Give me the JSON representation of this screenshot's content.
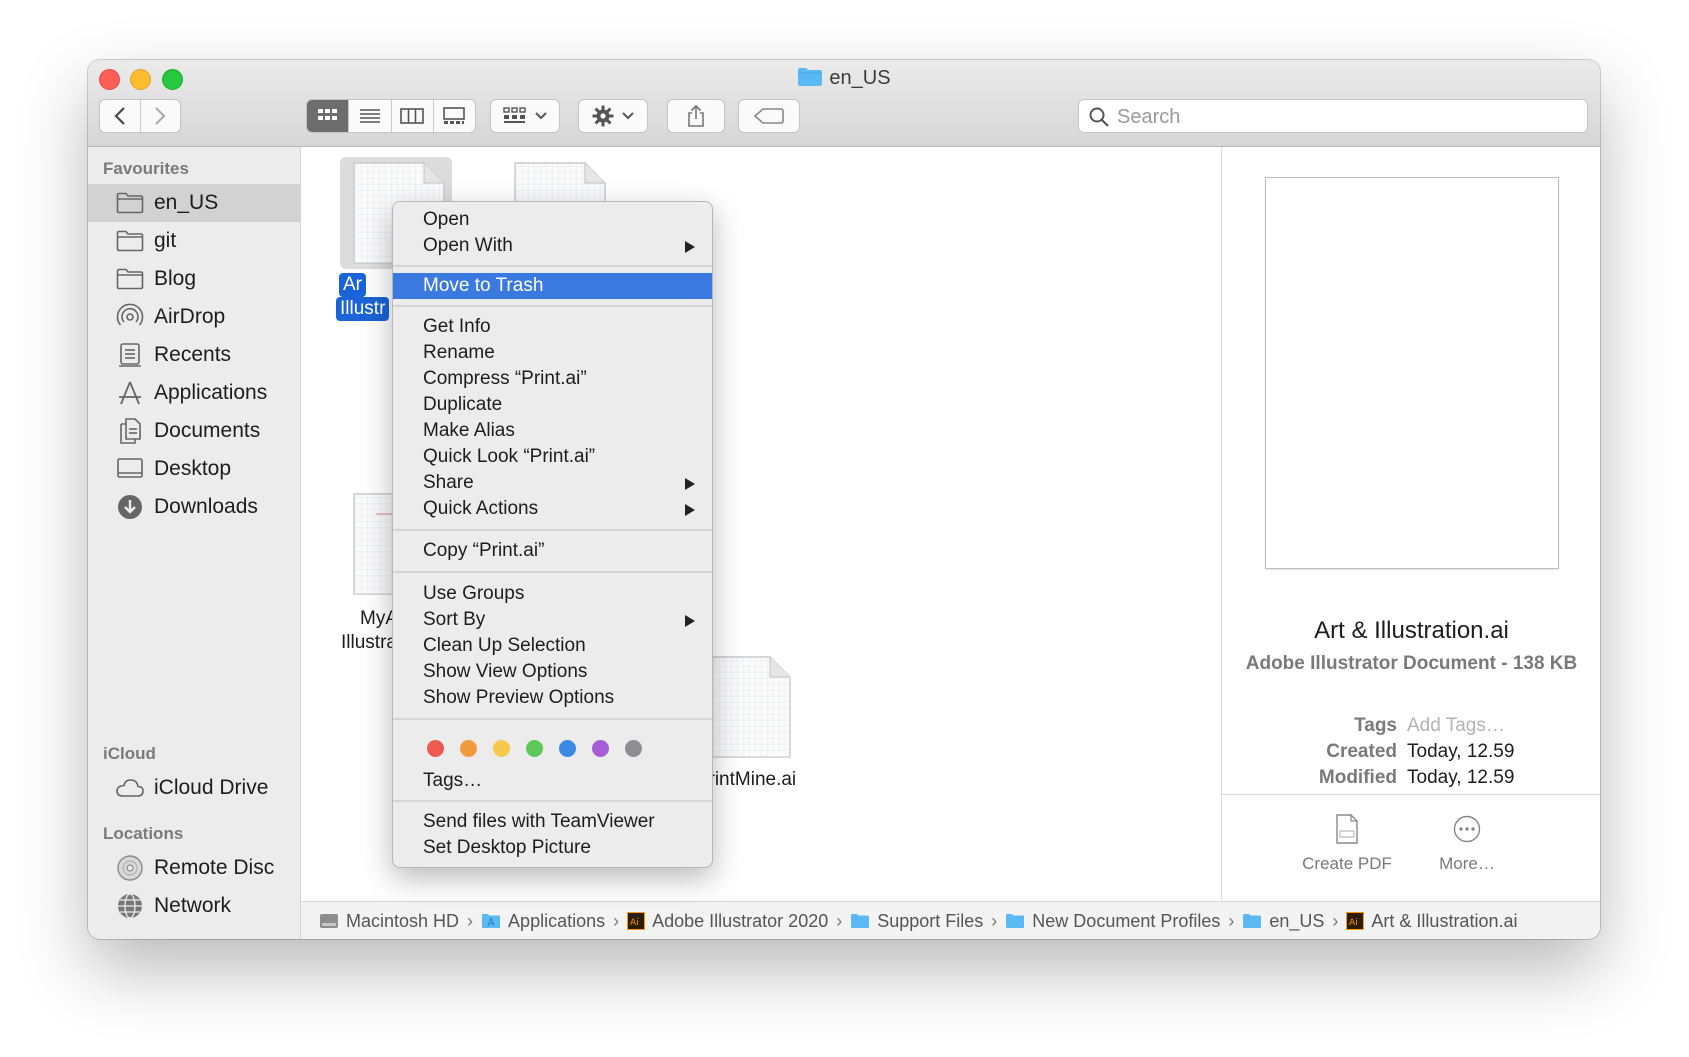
{
  "window": {
    "title": "en_US"
  },
  "toolbar": {
    "back_label": "<",
    "forward_label": ">",
    "search_placeholder": "Search",
    "search_value": ""
  },
  "sidebar": {
    "favourites_header": "Favourites",
    "favourites": [
      {
        "label": "en_US",
        "icon": "folder-icon",
        "selected": true
      },
      {
        "label": "git",
        "icon": "folder-icon"
      },
      {
        "label": "Blog",
        "icon": "folder-icon"
      },
      {
        "label": "AirDrop",
        "icon": "airdrop-icon"
      },
      {
        "label": "Recents",
        "icon": "recents-icon"
      },
      {
        "label": "Applications",
        "icon": "applications-icon"
      },
      {
        "label": "Documents",
        "icon": "documents-icon"
      },
      {
        "label": "Desktop",
        "icon": "desktop-icon"
      },
      {
        "label": "Downloads",
        "icon": "downloads-icon"
      }
    ],
    "icloud_header": "iCloud",
    "icloud": [
      {
        "label": "iCloud Drive",
        "icon": "cloud-icon"
      }
    ],
    "locations_header": "Locations",
    "locations": [
      {
        "label": "Remote Disc",
        "icon": "disc-icon"
      },
      {
        "label": "Network",
        "icon": "network-icon"
      }
    ]
  },
  "content": {
    "files": [
      {
        "label_line1": "Ar",
        "label_line2": "Illustr",
        "selected": true
      },
      {
        "label_line1": "",
        "label_line2": ""
      },
      {
        "label_line1": "MyA",
        "label_line2": "Illustra"
      },
      {
        "label_line1": "PrintMine.ai",
        "label_line2": ""
      }
    ]
  },
  "context_menu": {
    "groups": [
      [
        {
          "label": "Open"
        },
        {
          "label": "Open With",
          "submenu": true
        }
      ],
      [
        {
          "label": "Move to Trash",
          "highlighted": true
        }
      ],
      [
        {
          "label": "Get Info"
        },
        {
          "label": "Rename"
        },
        {
          "label": "Compress “Print.ai”"
        },
        {
          "label": "Duplicate"
        },
        {
          "label": "Make Alias"
        },
        {
          "label": "Quick Look “Print.ai”"
        },
        {
          "label": "Share",
          "submenu": true
        },
        {
          "label": "Quick Actions",
          "submenu": true
        }
      ],
      [
        {
          "label": "Copy “Print.ai”"
        }
      ],
      [
        {
          "label": "Use Groups"
        },
        {
          "label": "Sort By",
          "submenu": true
        },
        {
          "label": "Clean Up Selection"
        },
        {
          "label": "Show View Options"
        },
        {
          "label": "Show Preview Options"
        }
      ],
      [
        {
          "label": "Tags…"
        }
      ],
      [
        {
          "label": "Send files with TeamViewer"
        },
        {
          "label": "Set Desktop Picture"
        }
      ]
    ],
    "tag_colors": [
      "#ee5a4f",
      "#f19a3e",
      "#f5ca4c",
      "#5dc85c",
      "#3d8ae6",
      "#a65ed6",
      "#8e8e93"
    ],
    "highlight_color": "#3a79e0"
  },
  "preview": {
    "name": "Art & Illustration.ai",
    "kind": "Adobe Illustrator Document - 138 KB",
    "tags_label": "Tags",
    "tags_placeholder": "Add Tags…",
    "created_label": "Created",
    "created_value": "Today, 12.59",
    "modified_label": "Modified",
    "modified_value": "Today, 12.59",
    "action_create_pdf": "Create PDF",
    "action_more": "More…"
  },
  "pathbar": [
    {
      "label": "Macintosh HD",
      "icon": "hard-drive-icon"
    },
    {
      "label": "Applications",
      "icon": "applications-folder-icon"
    },
    {
      "label": "Adobe Illustrator 2020",
      "icon": "illustrator-icon"
    },
    {
      "label": "Support Files",
      "icon": "folder-icon"
    },
    {
      "label": "New Document Profiles",
      "icon": "folder-icon"
    },
    {
      "label": "en_US",
      "icon": "folder-icon"
    },
    {
      "label": "Art & Illustration.ai",
      "icon": "illustrator-icon"
    }
  ],
  "colors": {
    "accent": "#1b63d8",
    "sidebar_bg": "#ececec",
    "folder": "#5ab9f2"
  }
}
